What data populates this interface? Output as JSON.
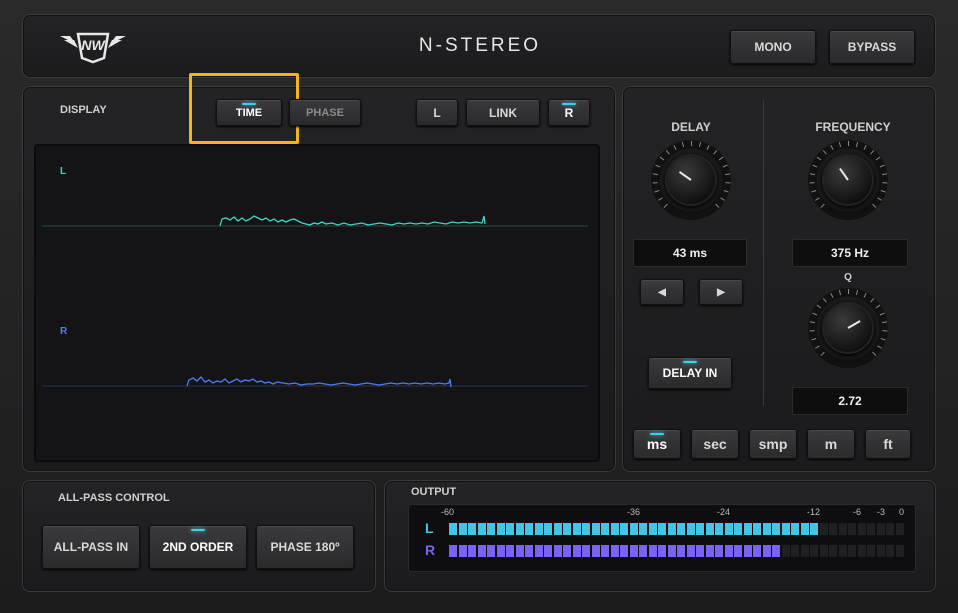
{
  "header": {
    "title": "N-STEREO",
    "logo_text": "NW",
    "mono_label": "MONO",
    "bypass_label": "BYPASS"
  },
  "display": {
    "section_label": "DISPLAY",
    "time_label": "TIME",
    "phase_label": "PHASE",
    "l_label": "L",
    "link_label": "LINK",
    "r_label": "R",
    "channel_l": "L",
    "channel_r": "R"
  },
  "delay": {
    "label": "DELAY",
    "value": "43 ms",
    "left_arrow": "◀",
    "right_arrow": "▶",
    "delay_in_label": "DELAY IN"
  },
  "frequency": {
    "label": "FREQUENCY",
    "value": "375 Hz"
  },
  "q": {
    "label": "Q",
    "value": "2.72"
  },
  "units": [
    {
      "label": "ms",
      "active": true
    },
    {
      "label": "sec",
      "active": false
    },
    {
      "label": "smp",
      "active": false
    },
    {
      "label": "m",
      "active": false
    },
    {
      "label": "ft",
      "active": false
    }
  ],
  "allpass": {
    "section_label": "ALL-PASS CONTROL",
    "allpass_in": "ALL-PASS IN",
    "second_order": "2ND ORDER",
    "phase180": "PHASE 180º"
  },
  "output": {
    "section_label": "OUTPUT",
    "scale": [
      "-60",
      "-36",
      "-24",
      "-12",
      "-6",
      "-3",
      "0"
    ],
    "channel_l": "L",
    "channel_r": "R",
    "level_l": 0.82,
    "level_r": 0.72,
    "color_l": "#3fc6e8",
    "color_r": "#7a63f0"
  },
  "colors": {
    "wave_l": "#3fd6c6",
    "wave_r": "#4f7cf0",
    "highlight": "#f2b51c",
    "led_on": "#3fd0e6"
  }
}
